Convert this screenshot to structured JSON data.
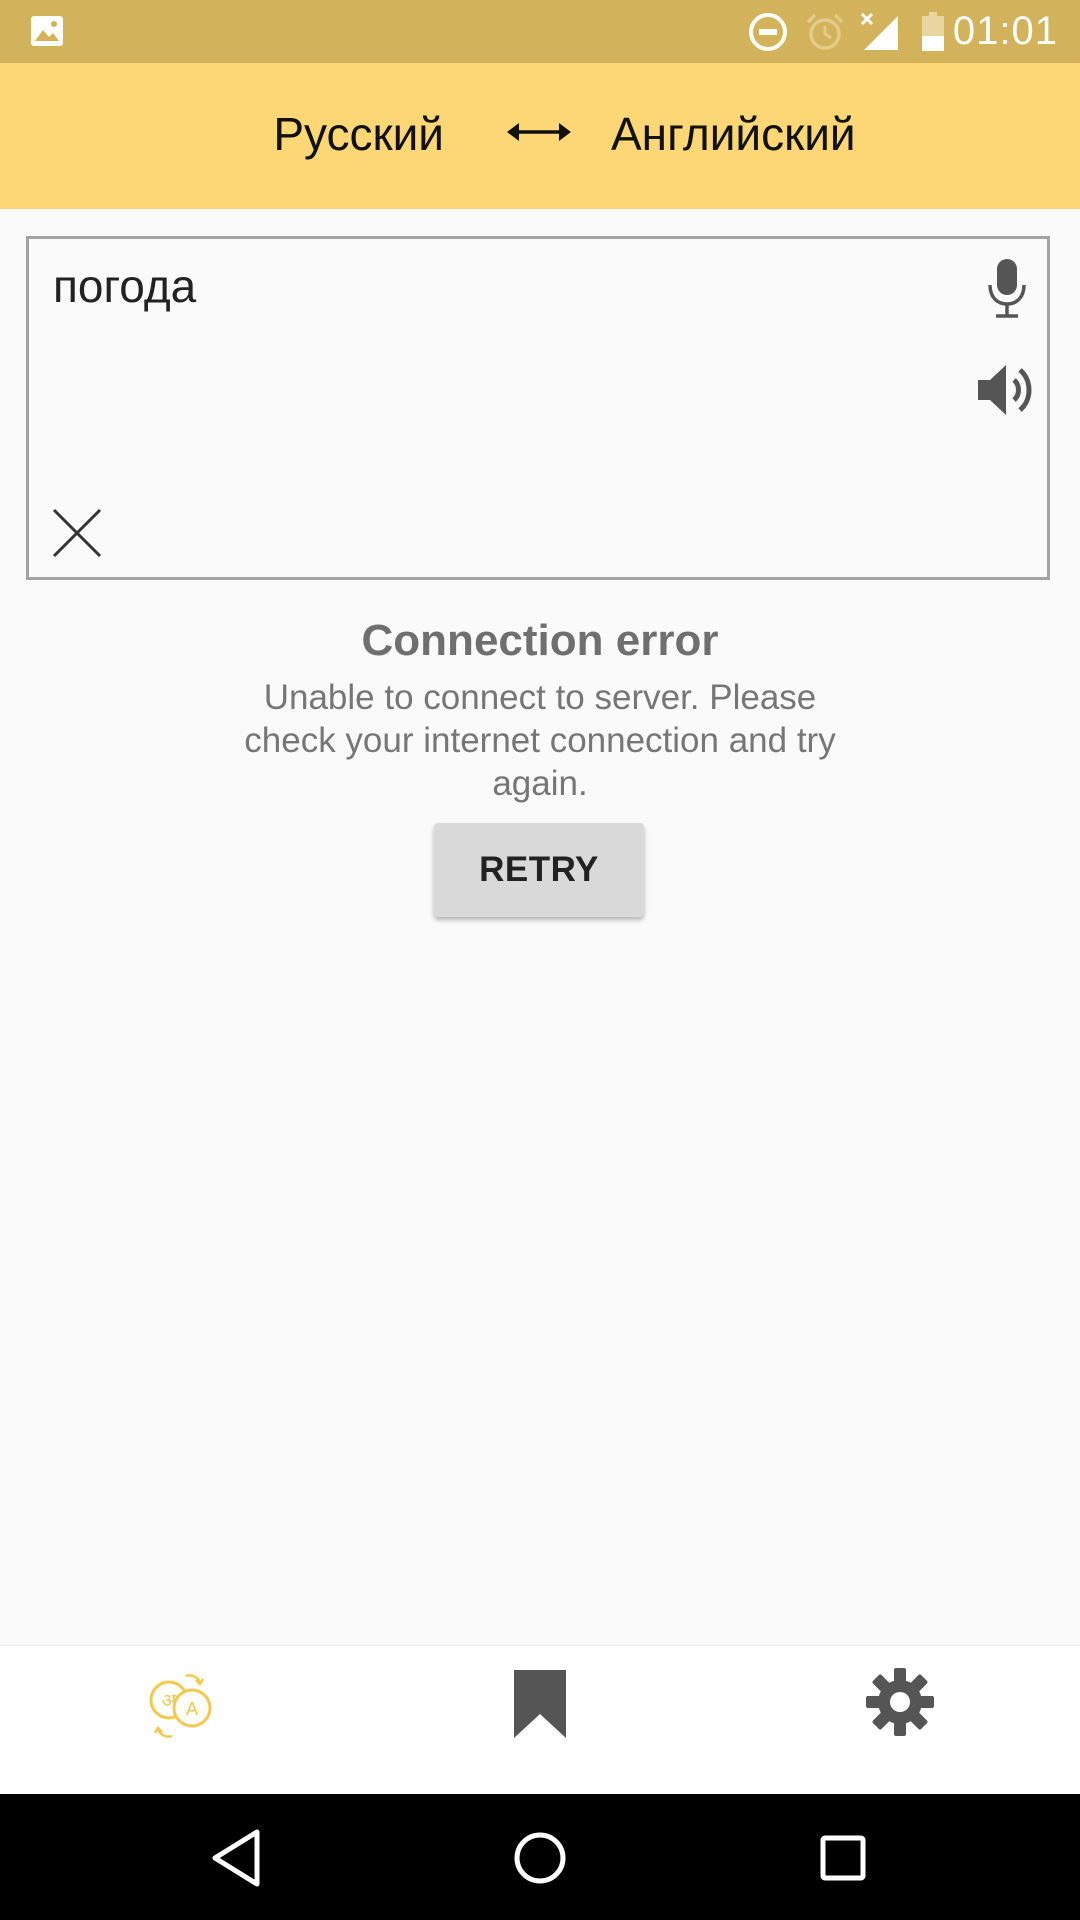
{
  "status_bar": {
    "time": "01:01"
  },
  "language_bar": {
    "source_language": "Русский",
    "target_language": "Английский"
  },
  "input": {
    "value": "погода"
  },
  "error": {
    "title": "Connection error",
    "message": "Unable to connect to server. Please check your internet connection and try again.",
    "retry_label": "RETRY"
  },
  "tabs": [
    {
      "icon": "translate-icon",
      "active": true
    },
    {
      "icon": "bookmark-icon",
      "active": false
    },
    {
      "icon": "gear-icon",
      "active": false
    }
  ],
  "colors": {
    "status_bar": "#d2b25a",
    "header": "#fdd775",
    "accent": "#f2c94c",
    "icon_gray": "#555555"
  }
}
